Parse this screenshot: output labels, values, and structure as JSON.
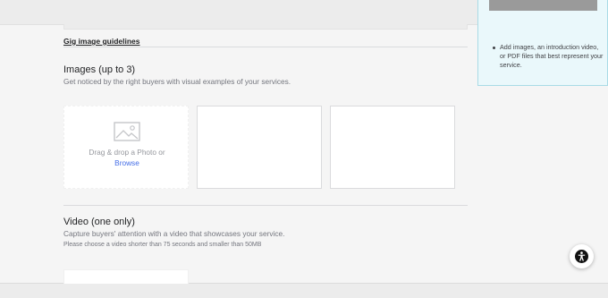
{
  "form": {
    "guidelines_link": "Gig image guidelines",
    "images_section": {
      "title": "Images (up to 3)",
      "description": "Get noticed by the right buyers with visual examples of your services.",
      "upload": {
        "drag_text": "Drag & drop a Photo or",
        "browse_label": "Browse"
      }
    },
    "video_section": {
      "title": "Video (one only)",
      "description": "Capture buyers' attention with a video that showcases your service.",
      "note": "Please choose a video shorter than 75 seconds and smaller than 50MB"
    }
  },
  "tip_panel": {
    "items": [
      "Add images, an introduction video, or PDF files that best represent your service."
    ]
  },
  "floating_button": {
    "icon": "accessibility-icon"
  },
  "colors": {
    "page_bg": "#f5f5f5",
    "tip_bg": "#eaf8fb",
    "tip_border": "#a9dbe6",
    "link": "#446ee7",
    "heading": "#222325",
    "muted": "#74767e"
  }
}
